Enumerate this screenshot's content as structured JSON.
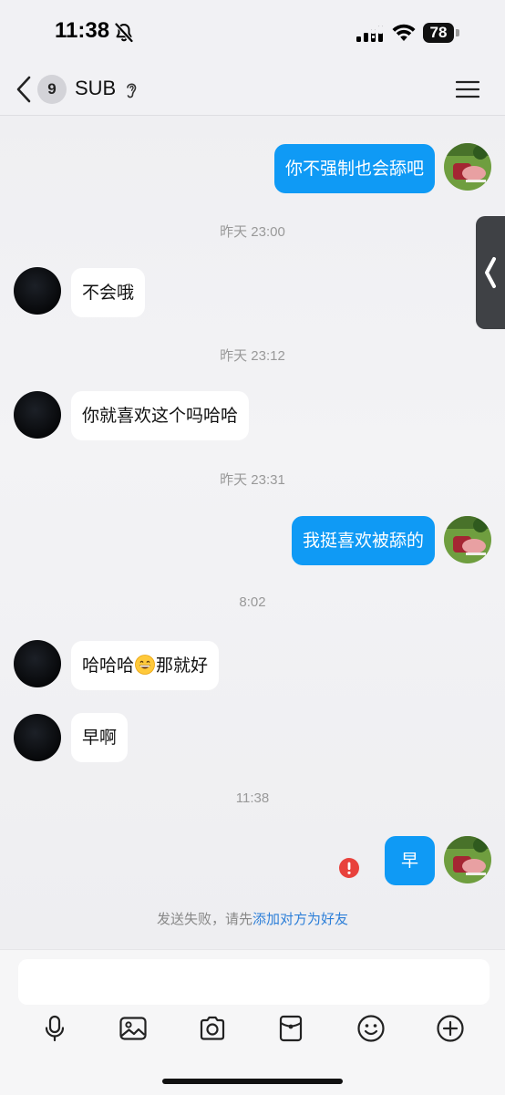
{
  "status_bar": {
    "time": "11:38",
    "battery": "78",
    "icons": [
      "bell-slash-icon",
      "signal-icon",
      "wifi-icon",
      "battery-icon"
    ]
  },
  "nav": {
    "back_icon": "chevron-left-icon",
    "unread_count": "9",
    "contact_name": "SUB",
    "ear_icon": "ear-icon",
    "menu_icon": "hamburger-menu-icon"
  },
  "messages": [
    {
      "type": "outgoing",
      "text": "你不强制也会舔吧"
    },
    {
      "type": "time",
      "text": "昨天 23:00"
    },
    {
      "type": "incoming",
      "text": "不会哦"
    },
    {
      "type": "time",
      "text": "昨天 23:12"
    },
    {
      "type": "incoming",
      "text": "你就喜欢这个吗哈哈"
    },
    {
      "type": "time",
      "text": "昨天 23:31"
    },
    {
      "type": "outgoing",
      "text": "我挺喜欢被舔的"
    },
    {
      "type": "time",
      "text": "8:02"
    },
    {
      "type": "incoming",
      "text_before": "哈哈哈",
      "emoji": "grinning-face-emoji",
      "text_after": "那就好"
    },
    {
      "type": "incoming",
      "text": "早啊"
    },
    {
      "type": "time",
      "text": "11:38"
    },
    {
      "type": "outgoing",
      "text": "早",
      "status": "failed"
    }
  ],
  "fail_notice": {
    "text": "发送失败，请先",
    "link": "添加对方为好友"
  },
  "input": {
    "placeholder": ""
  },
  "toolbar": [
    "microphone-icon",
    "image-icon",
    "camera-icon",
    "red-packet-icon",
    "emoji-icon",
    "plus-icon"
  ],
  "colors": {
    "outgoing_bubble": "#0f9af5",
    "incoming_bubble": "#ffffff",
    "background": "#f1f1f4",
    "error": "#e8413c",
    "link": "#2d7fd8"
  }
}
